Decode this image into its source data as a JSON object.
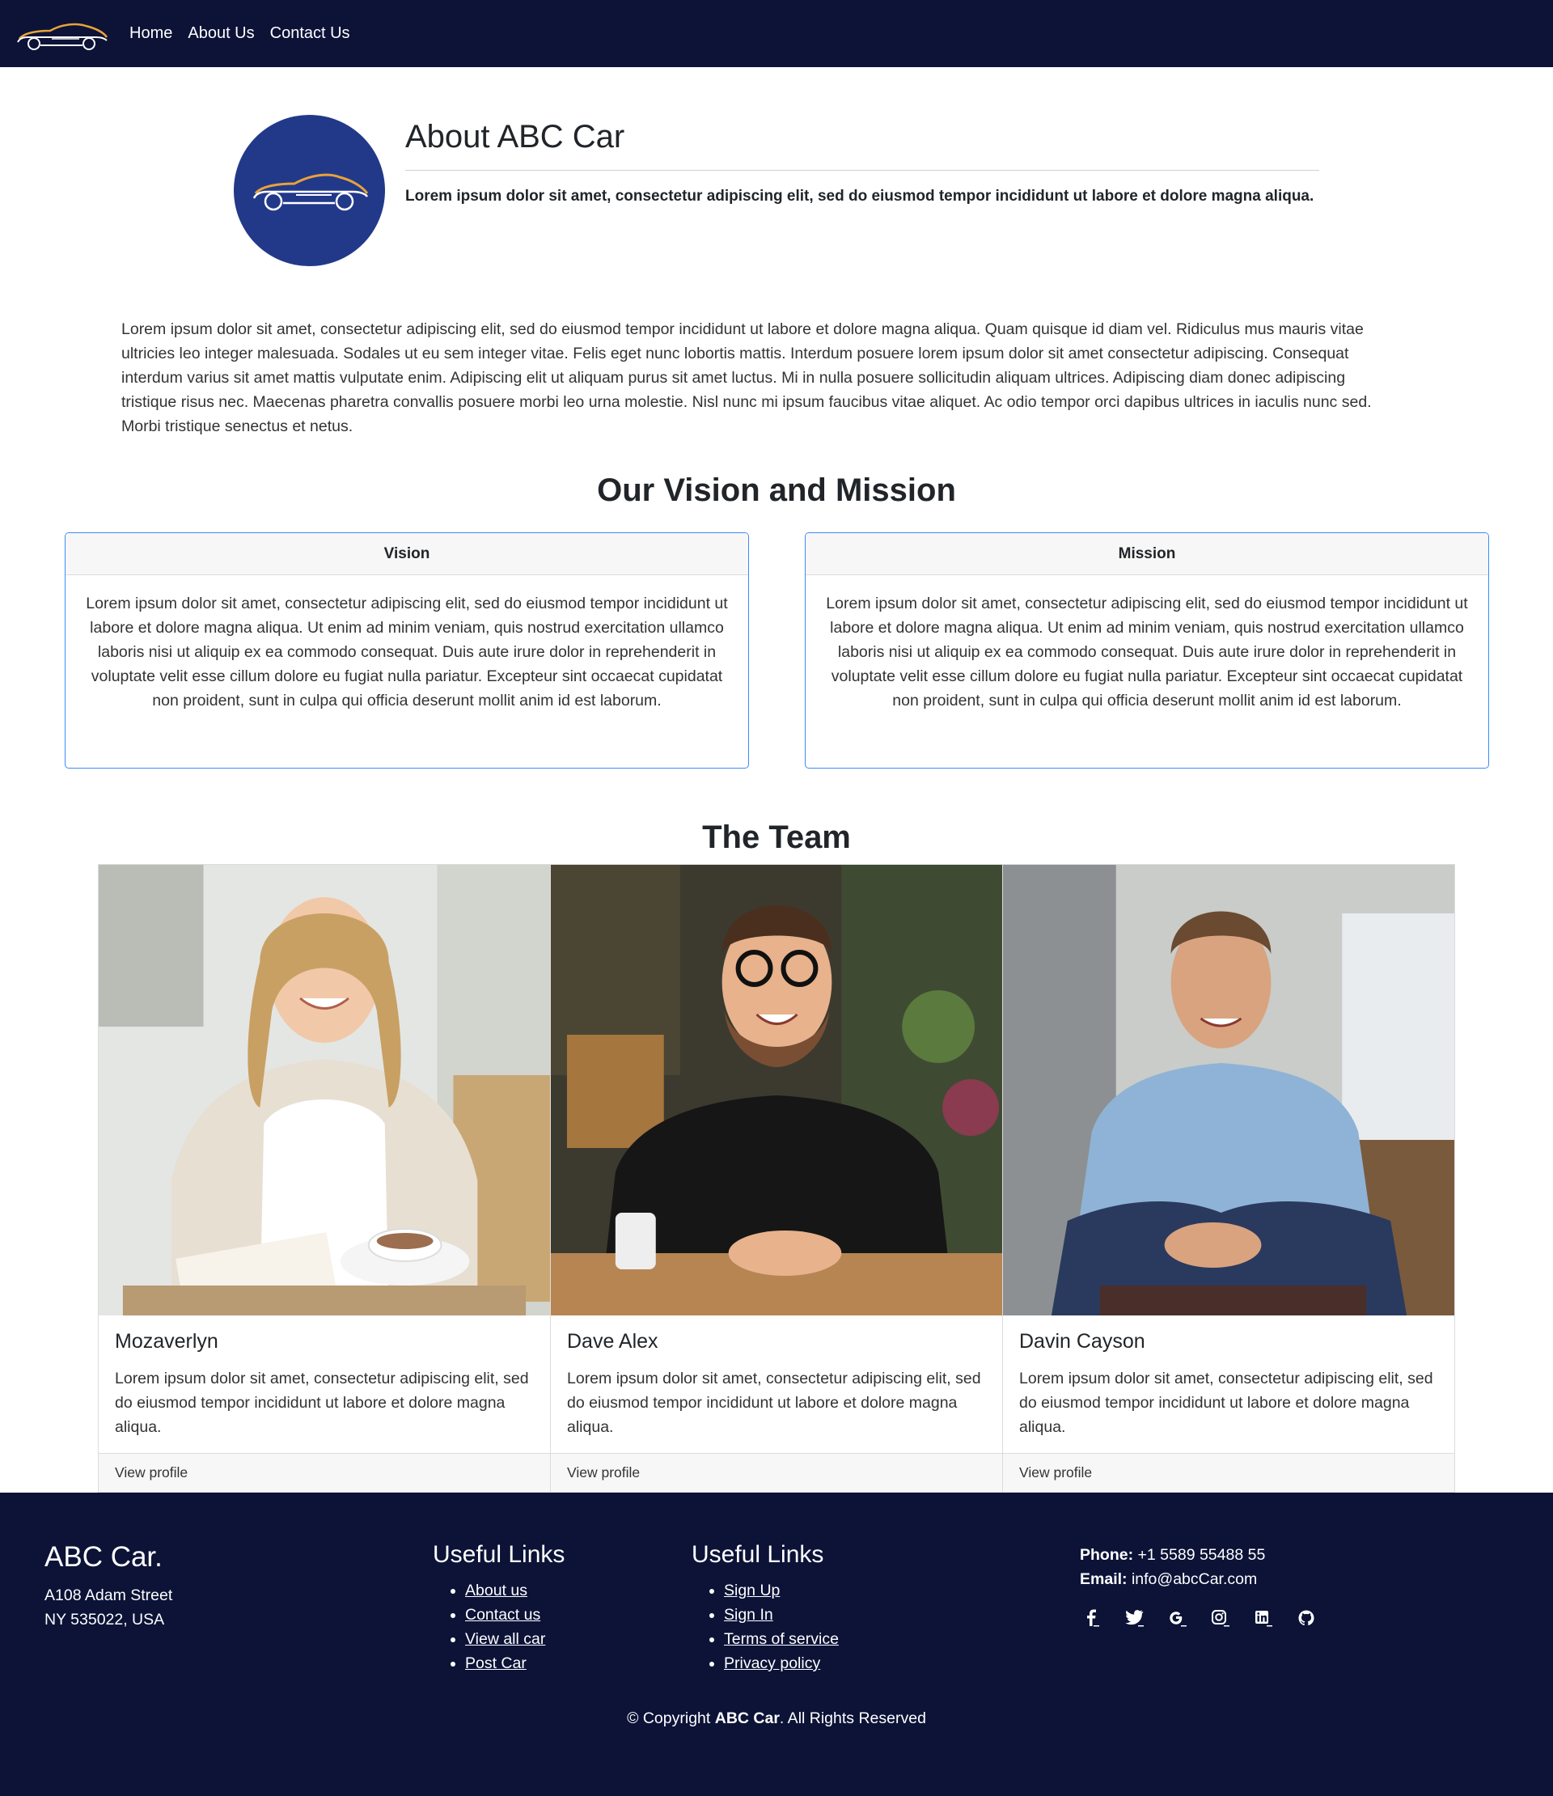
{
  "nav": {
    "logo_alt": "ABC Car logo",
    "links": [
      "Home",
      "About Us",
      "Contact Us"
    ]
  },
  "about": {
    "title": "About ABC Car",
    "lead": "Lorem ipsum dolor sit amet, consectetur adipiscing elit, sed do eiusmod tempor incididunt ut labore et dolore magna aliqua.",
    "intro": "Lorem ipsum dolor sit amet, consectetur adipiscing elit, sed do eiusmod tempor incididunt ut labore et dolore magna aliqua. Quam quisque id diam vel. Ridiculus mus mauris vitae ultricies leo integer malesuada. Sodales ut eu sem integer vitae. Felis eget nunc lobortis mattis. Interdum posuere lorem ipsum dolor sit amet consectetur adipiscing. Consequat interdum varius sit amet mattis vulputate enim. Adipiscing elit ut aliquam purus sit amet luctus. Mi in nulla posuere sollicitudin aliquam ultrices. Adipiscing diam donec adipiscing tristique risus nec. Maecenas pharetra convallis posuere morbi leo urna molestie. Nisl nunc mi ipsum faucibus vitae aliquet. Ac odio tempor orci dapibus ultrices in iaculis nunc sed. Morbi tristique senectus et netus."
  },
  "vision_mission": {
    "heading": "Our Vision and Mission",
    "vision": {
      "title": "Vision",
      "text": "Lorem ipsum dolor sit amet, consectetur adipiscing elit, sed do eiusmod tempor incididunt ut labore et dolore magna aliqua. Ut enim ad minim veniam, quis nostrud exercitation ullamco laboris nisi ut aliquip ex ea commodo consequat. Duis aute irure dolor in reprehenderit in voluptate velit esse cillum dolore eu fugiat nulla pariatur. Excepteur sint occaecat cupidatat non proident, sunt in culpa qui officia deserunt mollit anim id est laborum."
    },
    "mission": {
      "title": "Mission",
      "text": "Lorem ipsum dolor sit amet, consectetur adipiscing elit, sed do eiusmod tempor incididunt ut labore et dolore magna aliqua. Ut enim ad minim veniam, quis nostrud exercitation ullamco laboris nisi ut aliquip ex ea commodo consequat. Duis aute irure dolor in reprehenderit in voluptate velit esse cillum dolore eu fugiat nulla pariatur. Excepteur sint occaecat cupidatat non proident, sunt in culpa qui officia deserunt mollit anim id est laborum."
    }
  },
  "team": {
    "heading": "The Team",
    "members": [
      {
        "name": "Mozaverlyn",
        "desc": "Lorem ipsum dolor sit amet, consectetur adipiscing elit, sed do eiusmod tempor incididunt ut labore et dolore magna aliqua.",
        "link": "View profile"
      },
      {
        "name": "Dave Alex",
        "desc": "Lorem ipsum dolor sit amet, consectetur adipiscing elit, sed do eiusmod tempor incididunt ut labore et dolore magna aliqua.",
        "link": "View profile"
      },
      {
        "name": "Davin Cayson",
        "desc": "Lorem ipsum dolor sit amet, consectetur adipiscing elit, sed do eiusmod tempor incididunt ut labore et dolore magna aliqua.",
        "link": "View profile"
      }
    ]
  },
  "footer": {
    "brand": "ABC Car.",
    "address_line1": "A108 Adam Street",
    "address_line2": "NY 535022, USA",
    "links1": {
      "title": "Useful Links",
      "items": [
        "About us",
        "Contact us",
        "View all car",
        "Post Car"
      ]
    },
    "links2": {
      "title": "Useful Links",
      "items": [
        "Sign Up",
        "Sign In",
        "Terms of service",
        "Privacy policy"
      ]
    },
    "phone_label": "Phone:",
    "phone": "+1 5589 55488 55",
    "email_label": "Email:",
    "email": "info@abcCar.com",
    "social": [
      "facebook-icon",
      "twitter-icon",
      "google-icon",
      "instagram-icon",
      "linkedin-icon",
      "github-icon"
    ],
    "copy_prefix": "© Copyright",
    "copy_brand": "ABC Car",
    "copy_suffix": ". All Rights Reserved"
  },
  "colors": {
    "navy": "#0c1337",
    "logo_circle": "#22398a",
    "card_border": "#3d8bf8",
    "logo_gold": "#e8a23a"
  }
}
